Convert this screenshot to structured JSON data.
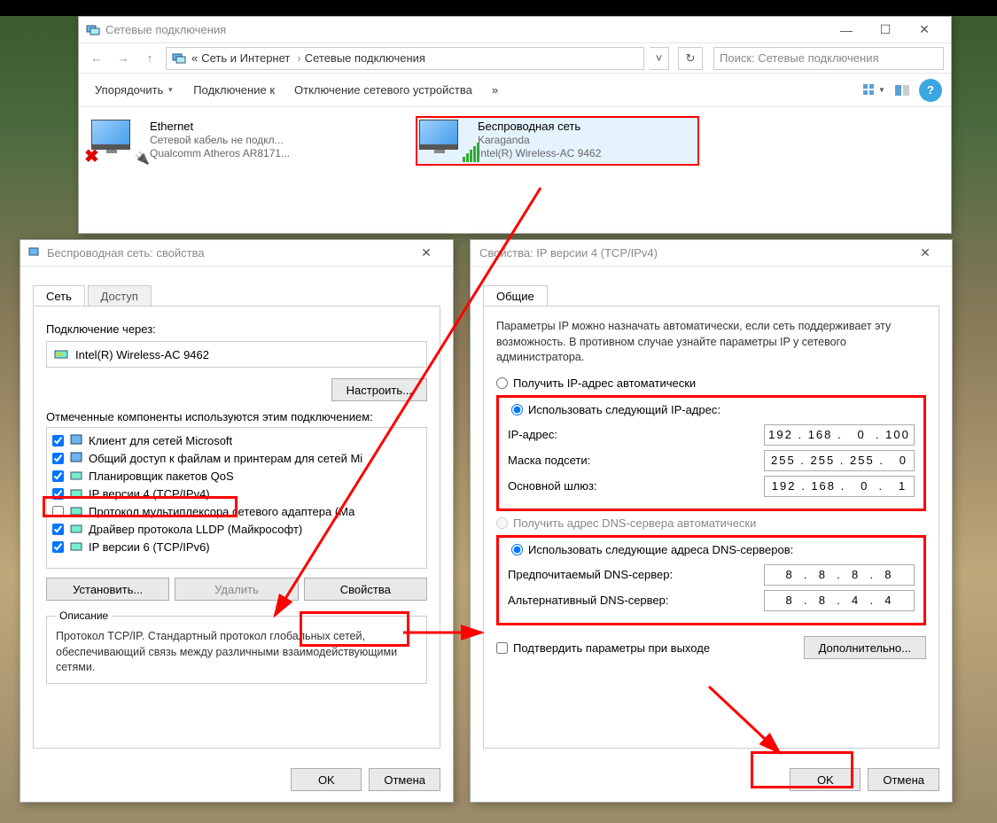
{
  "explorer": {
    "title": "Сетевые подключения",
    "breadcrumb": {
      "pre": "«",
      "a": "Сеть и Интернет",
      "b": "Сетевые подключения"
    },
    "search_placeholder": "Поиск: Сетевые подключения",
    "cmd": {
      "org": "Упорядочить",
      "conn": "Подключение к",
      "disable": "Отключение сетевого устройства",
      "more": "»"
    },
    "adapters": [
      {
        "name": "Ethernet",
        "l2": "Сетевой кабель не подкл...",
        "l3": "Qualcomm Atheros AR8171..."
      },
      {
        "name": "Беспроводная сеть",
        "l2": "Karaganda",
        "l3": "Intel(R) Wireless-AC 9462"
      }
    ]
  },
  "props1": {
    "title": "Беспроводная сеть: свойства",
    "tabs": {
      "net": "Сеть",
      "access": "Доступ"
    },
    "conn_label": "Подключение через:",
    "adapter": "Intel(R) Wireless-AC 9462",
    "configure": "Настроить...",
    "comps_label": "Отмеченные компоненты используются этим подключением:",
    "components": [
      {
        "label": "Клиент для сетей Microsoft",
        "checked": true
      },
      {
        "label": "Общий доступ к файлам и принтерам для сетей Mi",
        "checked": true
      },
      {
        "label": "Планировщик пакетов QoS",
        "checked": true
      },
      {
        "label": "IP версии 4 (TCP/IPv4)",
        "checked": true
      },
      {
        "label": "Протокол мультиплексора сетевого адаптера (Ма",
        "checked": false
      },
      {
        "label": "Драйвер протокола LLDP (Майкрософт)",
        "checked": true
      },
      {
        "label": "IP версии 6 (TCP/IPv6)",
        "checked": true
      }
    ],
    "install": "Установить...",
    "remove": "Удалить",
    "properties": "Свойства",
    "desc_title": "Описание",
    "desc": "Протокол TCP/IP. Стандартный протокол глобальных сетей, обеспечивающий связь между различными взаимодействующими сетями.",
    "ok": "OK",
    "cancel": "Отмена"
  },
  "props2": {
    "title": "Свойства: IP версии 4 (TCP/IPv4)",
    "tab": "Общие",
    "intro": "Параметры IP можно назначать автоматически, если сеть поддерживает эту возможность. В противном случае узнайте параметры IP у сетевого администратора.",
    "auto_ip": "Получить IP-адрес автоматически",
    "manual_ip": "Использовать следующий IP-адрес:",
    "ip_label": "IP-адрес:",
    "ip": "192 . 168 .   0  . 100",
    "mask_label": "Маска подсети:",
    "mask": "255 . 255 . 255 .   0",
    "gw_label": "Основной шлюз:",
    "gw": "192 . 168 .   0  .   1",
    "auto_dns": "Получить адрес DNS-сервера автоматически",
    "manual_dns": "Использовать следующие адреса DNS-серверов:",
    "dns1_label": "Предпочитаемый DNS-сервер:",
    "dns1": "8  .  8  .  8  .  8",
    "dns2_label": "Альтернативный DNS-сервер:",
    "dns2": "8  .  8  .  4  .  4",
    "validate": "Подтвердить параметры при выходе",
    "advanced": "Дополнительно...",
    "ok": "OK",
    "cancel": "Отмена"
  }
}
